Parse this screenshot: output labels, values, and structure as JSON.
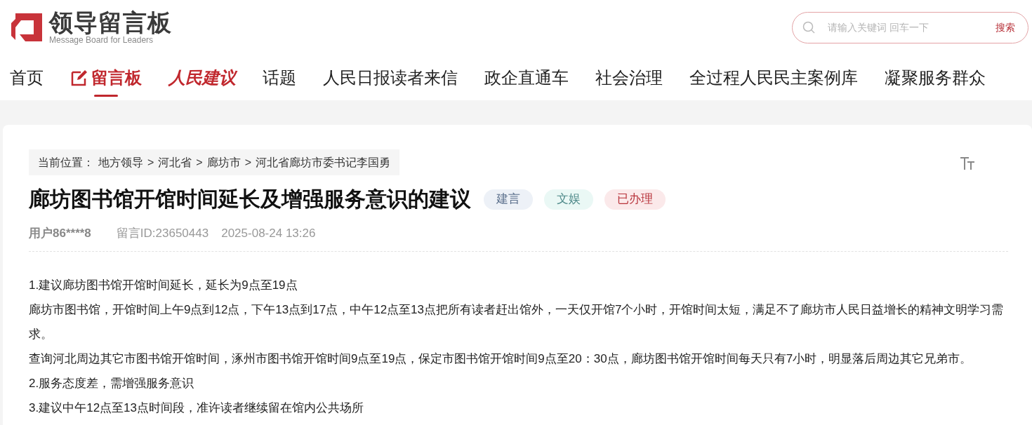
{
  "logo": {
    "title": "领导留言板",
    "subtitle": "Message Board for Leaders"
  },
  "search": {
    "placeholder": "请输入关键词 回车一下",
    "button": "搜索"
  },
  "nav": [
    {
      "label": "首页",
      "kind": "text",
      "selected": false
    },
    {
      "label": "留言板",
      "kind": "board",
      "selected": true
    },
    {
      "label": "人民建议",
      "kind": "brand",
      "selected": false
    },
    {
      "label": "话题",
      "kind": "text",
      "selected": false
    },
    {
      "label": "人民日报读者来信",
      "kind": "text",
      "selected": false
    },
    {
      "label": "政企直通车",
      "kind": "text",
      "selected": false
    },
    {
      "label": "社会治理",
      "kind": "text",
      "selected": false
    },
    {
      "label": "全过程人民民主案例库",
      "kind": "text",
      "selected": false
    },
    {
      "label": "凝聚服务群众",
      "kind": "text",
      "selected": false
    }
  ],
  "breadcrumb": {
    "prefix": "当前位置：",
    "items": [
      "地方领导",
      "河北省",
      "廊坊市",
      "河北省廊坊市委书记李国勇"
    ],
    "separator": ">"
  },
  "post": {
    "title": "廊坊图书馆开馆时间延长及增强服务意识的建议",
    "tags": [
      {
        "label": "建言",
        "color": "#edf1f7"
      },
      {
        "label": "文娱",
        "color": "#eaf8f5"
      },
      {
        "label": "已办理",
        "color": "#fbe9ea"
      }
    ],
    "user": "用户86****8",
    "id": "留言ID:23650443",
    "time": "2025-08-24 13:26",
    "body": [
      "1.建议廊坊图书馆开馆时间延长，延长为9点至19点",
      "廊坊市图书馆，开馆时间上午9点到12点，下午13点到17点，中午12点至13点把所有读者赶出馆外，一天仅开馆7个小时，开馆时间太短，满足不了廊坊市人民日益增长的精神文明学习需求。",
      "查询河北周边其它市图书馆开馆时间，涿州市图书馆开馆时间9点至19点，保定市图书馆开馆时间9点至20：30点，廊坊图书馆开馆时间每天只有7小时，明显落后周边其它兄弟市。",
      "2.服务态度差，需增强服务意识",
      "3.建议中午12点至13点时间段，准许读者继续留在馆内公共场所"
    ]
  }
}
